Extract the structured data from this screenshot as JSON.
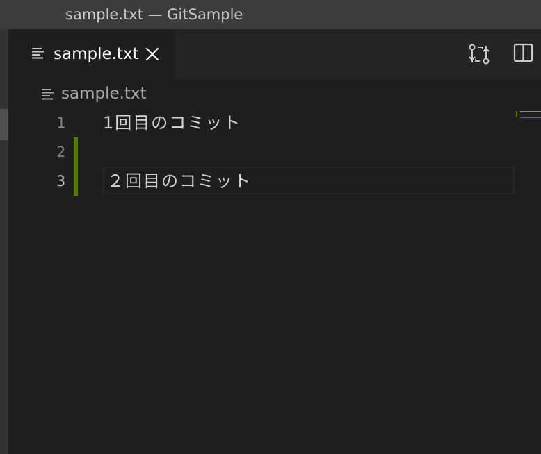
{
  "window": {
    "title": "sample.txt — GitSample"
  },
  "tabs": [
    {
      "label": "sample.txt",
      "active": true,
      "icon": "text-file-icon"
    }
  ],
  "tab_actions": [
    {
      "name": "open-changes-button",
      "icon": "git-compare-icon"
    },
    {
      "name": "split-editor-button",
      "icon": "split-editor-icon"
    }
  ],
  "breadcrumb": {
    "items": [
      {
        "label": "sample.txt",
        "icon": "text-file-icon"
      }
    ]
  },
  "editor": {
    "lines": [
      {
        "number": "1",
        "text": "1回目のコミット",
        "gutter": "none"
      },
      {
        "number": "2",
        "text": "",
        "gutter": "added"
      },
      {
        "number": "3",
        "text": "２回目のコミット",
        "gutter": "added",
        "current": true
      }
    ]
  },
  "colors": {
    "editor_background": "#1e1e1e",
    "titlebar_background": "#3c3c3c",
    "tabbar_background": "#252526",
    "gutter_added": "#587c0c",
    "text": "#d4d4d4",
    "line_number": "#858585"
  }
}
